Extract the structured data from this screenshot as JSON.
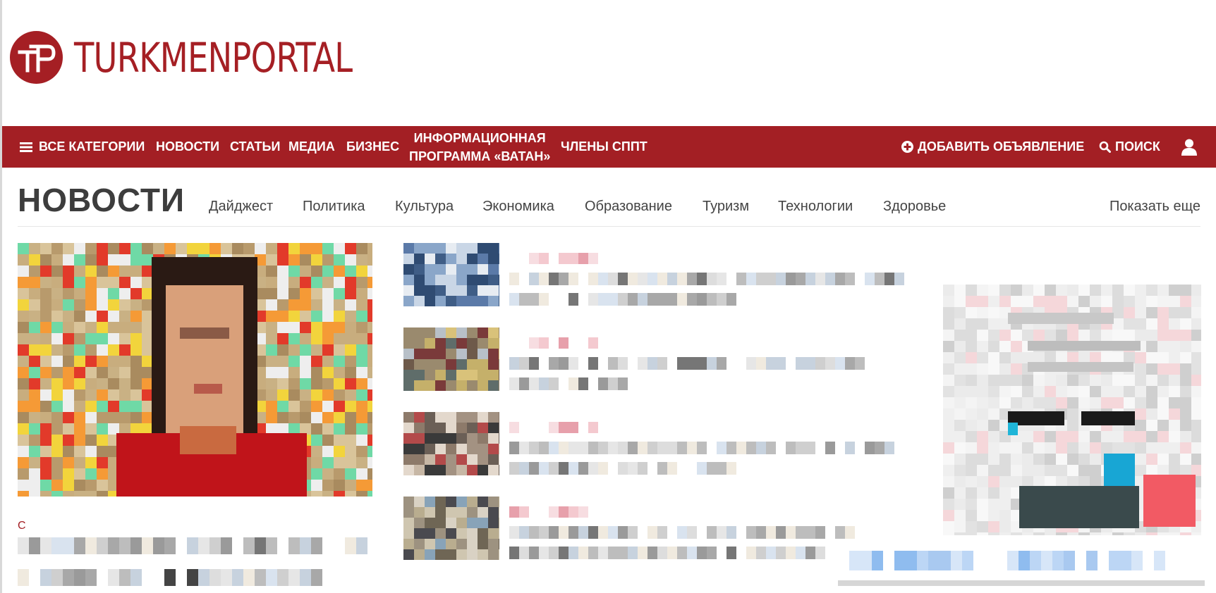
{
  "brand": {
    "name": "TURKMENPORTAL",
    "logo_letters": "TP",
    "color": "#a31f24"
  },
  "nav": {
    "all_categories": "ВСЕ КАТЕГОРИИ",
    "news": "НОВОСТИ",
    "articles": "СТАТЬИ",
    "media": "МЕДИА",
    "business": "БИЗНЕС",
    "vatan_line1": "ИНФОРМАЦИОННАЯ",
    "vatan_line2": "ПРОГРАММА «ВАТАН»",
    "members": "ЧЛЕНЫ СППТ",
    "add_listing": "ДОБАВИТЬ ОБЪЯВЛЕНИЕ",
    "search": "ПОИСК",
    "icons": {
      "menu": "hamburger-icon",
      "add": "plus-circle-icon",
      "search": "search-icon",
      "user": "user-icon"
    }
  },
  "section": {
    "title": "НОВОСТИ",
    "subnav": [
      "Дайджест",
      "Политика",
      "Культура",
      "Экономика",
      "Образование",
      "Туризм",
      "Технологии",
      "Здоровье"
    ],
    "show_more": "Показать еще"
  },
  "featured": {
    "category_initial": "С"
  }
}
